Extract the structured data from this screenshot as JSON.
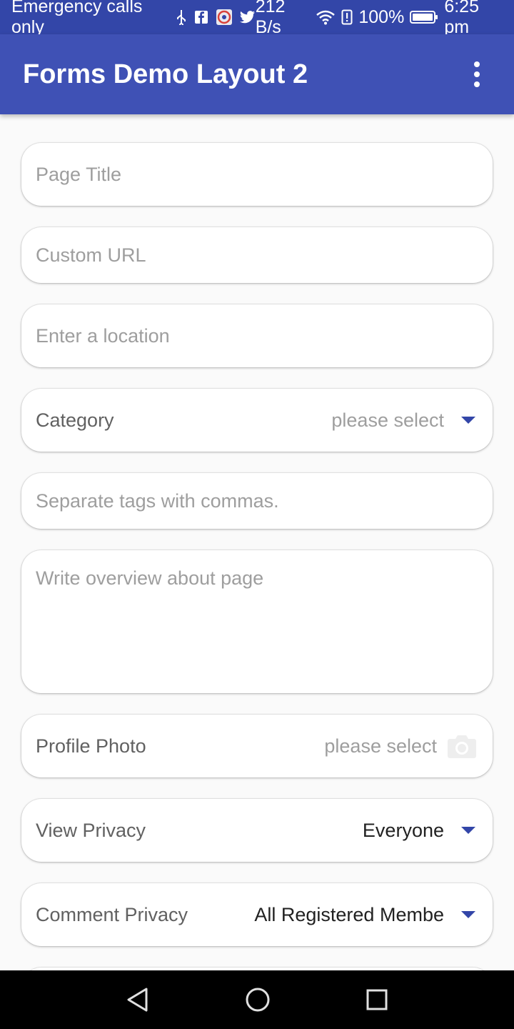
{
  "status_bar": {
    "carrier": "Emergency calls only",
    "net_speed": "212 B/s",
    "battery": "100%",
    "time": "6:25 pm",
    "icons": [
      "usb-icon",
      "facebook-icon",
      "app-icon",
      "twitter-icon",
      "wifi-icon",
      "alert-icon",
      "battery-icon"
    ]
  },
  "app_bar": {
    "title": "Forms Demo Layout 2",
    "menu_icon": "more-vert-icon",
    "color": "#3f51b5"
  },
  "form": {
    "page_title": {
      "placeholder": "Page Title"
    },
    "custom_url": {
      "placeholder": "Custom URL"
    },
    "location": {
      "placeholder": "Enter a location"
    },
    "category": {
      "label": "Category",
      "value": "please select"
    },
    "tags": {
      "placeholder": "Separate tags with commas."
    },
    "overview": {
      "placeholder": "Write overview about page"
    },
    "profile_photo": {
      "label": "Profile Photo",
      "value": "please select",
      "icon": "camera-icon"
    },
    "view_privacy": {
      "label": "View Privacy",
      "value": "Everyone"
    },
    "comment_privacy": {
      "label": "Comment Privacy",
      "value": "All Registered Membe"
    }
  },
  "nav_bar": {
    "icons": [
      "back-icon",
      "home-icon",
      "recents-icon"
    ]
  }
}
